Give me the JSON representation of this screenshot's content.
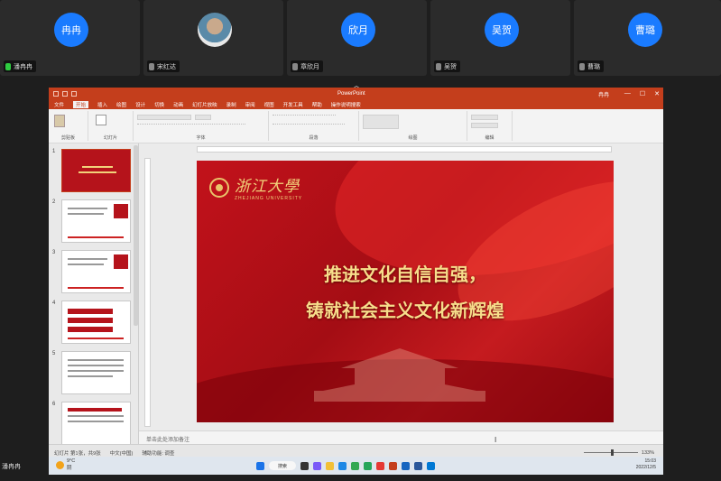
{
  "participants": [
    {
      "avatar_text": "冉冉",
      "name": "潘冉冉",
      "mic_on": true
    },
    {
      "avatar_text": "",
      "name": "宋红达",
      "mic_on": false
    },
    {
      "avatar_text": "欣月",
      "name": "章欣月",
      "mic_on": false
    },
    {
      "avatar_text": "吴贺",
      "name": "吴贺",
      "mic_on": false
    },
    {
      "avatar_text": "曹璐",
      "name": "曹璐",
      "mic_on": false
    }
  ],
  "window": {
    "app_title": "PowerPoint",
    "user": "冉冉"
  },
  "ribbon_tabs": [
    "文件",
    "开始",
    "插入",
    "绘图",
    "设计",
    "切换",
    "动画",
    "幻灯片放映",
    "录制",
    "审阅",
    "视图",
    "开发工具",
    "帮助",
    "操作说明搜索"
  ],
  "ribbon_groups": [
    "剪贴板",
    "幻灯片",
    "字体",
    "段落",
    "绘图",
    "编辑"
  ],
  "slide_numbers": [
    "1",
    "2",
    "3",
    "4",
    "5",
    "6"
  ],
  "slide": {
    "logo_cn": "浙江大學",
    "logo_en": "ZHEJIANG UNIVERSITY",
    "headline_1": "推进文化自信自强，",
    "headline_2": "铸就社会主义文化新辉煌"
  },
  "notes_placeholder": "单击此处添加备注",
  "status": {
    "slide_count": "幻灯片 第1张，共9张",
    "language": "中文(中国)",
    "accessibility": "辅助功能: 调查",
    "zoom": "133%"
  },
  "taskbar": {
    "weather_temp": "9°C",
    "weather_desc": "阴",
    "search": "搜索",
    "time": "15:03",
    "date": "2022/12/5"
  },
  "self_name": "潘冉冉",
  "colors": {
    "ppt_accent": "#c43e1c",
    "slide_red": "#b5131b",
    "headline_gold": "#f7dd8b",
    "avatar_blue": "#1a7bff"
  }
}
